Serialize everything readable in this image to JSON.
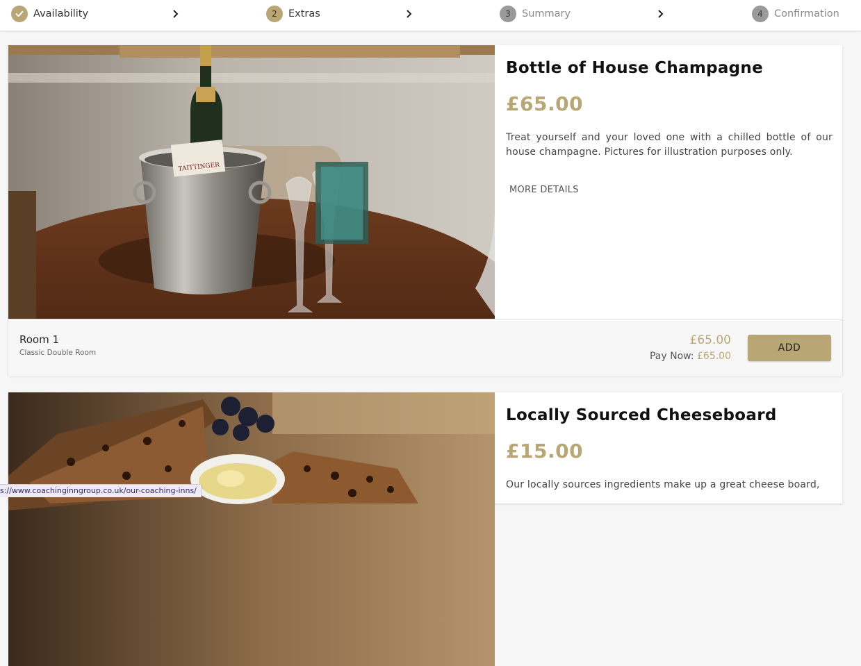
{
  "steps": [
    {
      "badge": "",
      "label": "Availability",
      "state": "done"
    },
    {
      "badge": "2",
      "label": "Extras",
      "state": "active"
    },
    {
      "badge": "3",
      "label": "Summary",
      "state": "pending"
    },
    {
      "badge": "4",
      "label": "Confirmation",
      "state": "pending"
    }
  ],
  "icons": {
    "step_done": "check-icon",
    "step_separator": "chevron-right-icon"
  },
  "colors": {
    "accent": "#b8a774",
    "pending_badge": "#9a9a9a",
    "title": "#111111"
  },
  "extras": [
    {
      "title": "Bottle of House Champagne",
      "price": "£65.00",
      "description": "Treat yourself and your loved one with a chilled bottle of our house champagne. Pictures for illustration purposes only.",
      "more_details": "MORE DETAILS",
      "room_name": "Room 1",
      "room_type": "Classic Double Room",
      "total": "£65.00",
      "pay_now_label": "Pay Now:",
      "pay_now_value": "£65.00",
      "add_label": "ADD"
    },
    {
      "title": "Locally Sourced Cheeseboard",
      "price": "£15.00",
      "description": "Our locally sources ingredients make up a great cheese board,"
    }
  ],
  "status_bar": {
    "url": "s://www.coachinginngroup.co.uk/our-coaching-inns/"
  }
}
